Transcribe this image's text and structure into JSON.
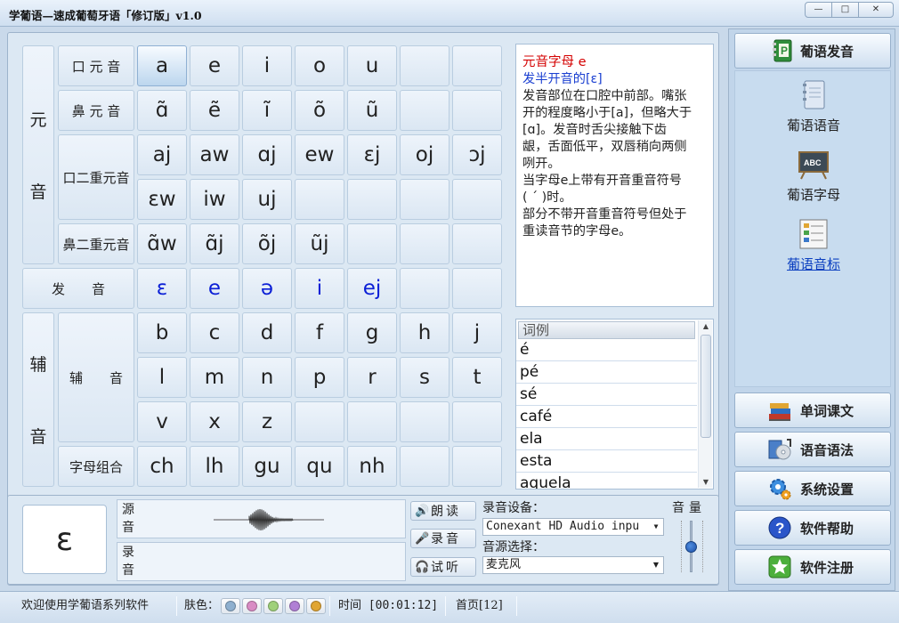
{
  "window": {
    "title": "学葡语—速成葡萄牙语「修订版」v1.0",
    "controls": [
      "—",
      "□",
      "✕"
    ]
  },
  "rows": [
    {
      "label": "口 元 音",
      "cells": [
        "a",
        "e",
        "i",
        "o",
        "u",
        "",
        ""
      ]
    },
    {
      "label": "鼻 元 音",
      "cells": [
        "ɑ̃",
        "ẽ",
        "ĩ",
        "õ",
        "ũ",
        "",
        ""
      ]
    },
    {
      "label": "口二重元音",
      "cells": [
        "aj",
        "aw",
        "ɑj",
        "ew",
        "ɛj",
        "oj",
        "ɔj"
      ]
    },
    {
      "cells": [
        "ɛw",
        "iw",
        "uj",
        "",
        "",
        "",
        ""
      ]
    },
    {
      "label": "鼻二重元音",
      "cells": [
        "ɑ̃w",
        "ɑ̃j",
        "õj",
        "ũj",
        "",
        "",
        ""
      ]
    },
    {
      "label": "发　　音",
      "cells": [
        "ɛ",
        "e",
        "ə",
        "i",
        "ej",
        "",
        ""
      ]
    },
    {
      "cells": [
        "b",
        "c",
        "d",
        "f",
        "g",
        "h",
        "j"
      ]
    },
    {
      "label": "辅　　音",
      "cells": [
        "l",
        "m",
        "n",
        "p",
        "r",
        "s",
        "t"
      ]
    },
    {
      "cells": [
        "v",
        "x",
        "z",
        "",
        "",
        "",
        ""
      ]
    },
    {
      "label": "字母组合",
      "cells": [
        "ch",
        "lh",
        "gu",
        "qu",
        "nh",
        "",
        ""
      ]
    }
  ],
  "groups": {
    "vowel": [
      "元",
      "音"
    ],
    "consonant": [
      "辅",
      "音"
    ]
  },
  "description": {
    "title": "元音字母 e",
    "subtitle": "发半开音的[ɛ]",
    "lines": [
      "发音部位在口腔中前部。嘴张",
      "开的程度略小于[a]，但略大于",
      "[ɑ]。发音时舌尖接触下齿",
      "龈，舌面低平，双唇稍向两侧",
      "咧开。",
      "当字母e上带有开音重音符号",
      "( ´ )时。",
      "部分不带开音重音符号但处于",
      "重读音节的字母e。"
    ]
  },
  "wordlist": {
    "header": "词例",
    "items": [
      "é",
      "pé",
      "sé",
      "café",
      "ela",
      "esta",
      "aquela"
    ]
  },
  "bottom": {
    "current_char": "ɛ",
    "source_label": [
      "源",
      "音"
    ],
    "record_label": [
      "录",
      "音"
    ],
    "btn_read": "朗读",
    "btn_record": "录音",
    "btn_listen": "试听",
    "device_label": "录音设备：",
    "device_value": "Conexant HD Audio inpu",
    "source_select_label": "音源选择：",
    "source_select_value": "麦克风",
    "volume_label": "音量",
    "volume_level": 0.55
  },
  "sidebar": {
    "header": "葡语发音",
    "nav": [
      "葡语语音",
      "葡语字母",
      "葡语音标"
    ],
    "active_nav": 2,
    "buttons": [
      "单词课文",
      "语音语法",
      "系统设置",
      "软件帮助",
      "软件注册"
    ]
  },
  "status": {
    "welcome": "欢迎使用学葡语系列软件",
    "skin_label": "肤色：",
    "skins": [
      "#8fb0cf",
      "#d98cc4",
      "#9fd07a",
      "#b07fd4",
      "#e0a532"
    ],
    "time": "时间 [00:01:12]",
    "page": "首页[12]"
  }
}
